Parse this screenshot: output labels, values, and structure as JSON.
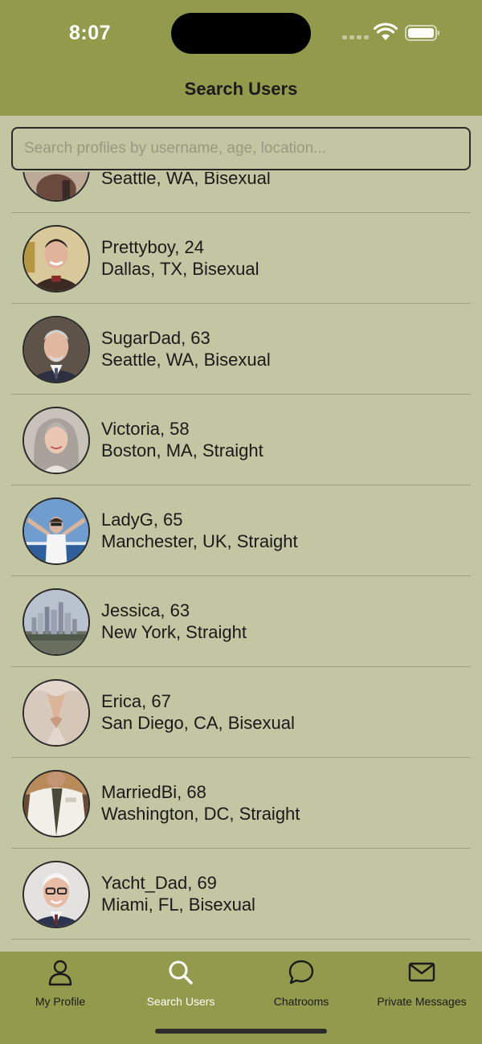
{
  "status_bar": {
    "time": "8:07"
  },
  "header": {
    "title": "Search Users"
  },
  "search": {
    "placeholder": "Search profiles by username, age, location...",
    "value": ""
  },
  "users": [
    {
      "name_age": "",
      "details": "Seattle, WA, Bisexual"
    },
    {
      "name_age": "Prettyboy, 24",
      "details": "Dallas, TX, Bisexual"
    },
    {
      "name_age": "SugarDad, 63",
      "details": "Seattle, WA, Bisexual"
    },
    {
      "name_age": "Victoria, 58",
      "details": "Boston, MA, Straight"
    },
    {
      "name_age": "LadyG, 65",
      "details": "Manchester, UK, Straight"
    },
    {
      "name_age": "Jessica, 63",
      "details": "New York, Straight"
    },
    {
      "name_age": "Erica, 67",
      "details": "San Diego, CA, Bisexual"
    },
    {
      "name_age": "MarriedBi, 68",
      "details": "Washington, DC, Straight"
    },
    {
      "name_age": "Yacht_Dad, 69",
      "details": "Miami, FL, Bisexual"
    }
  ],
  "tabs": [
    {
      "label": "My Profile",
      "icon": "person-icon"
    },
    {
      "label": "Search Users",
      "icon": "search-icon",
      "active": true
    },
    {
      "label": "Chatrooms",
      "icon": "chat-bubble-icon"
    },
    {
      "label": "Private Messages",
      "icon": "envelope-icon"
    }
  ],
  "colors": {
    "bar": "#939a4c",
    "background": "#c2c6a2",
    "active_tab": "#ffffff"
  }
}
